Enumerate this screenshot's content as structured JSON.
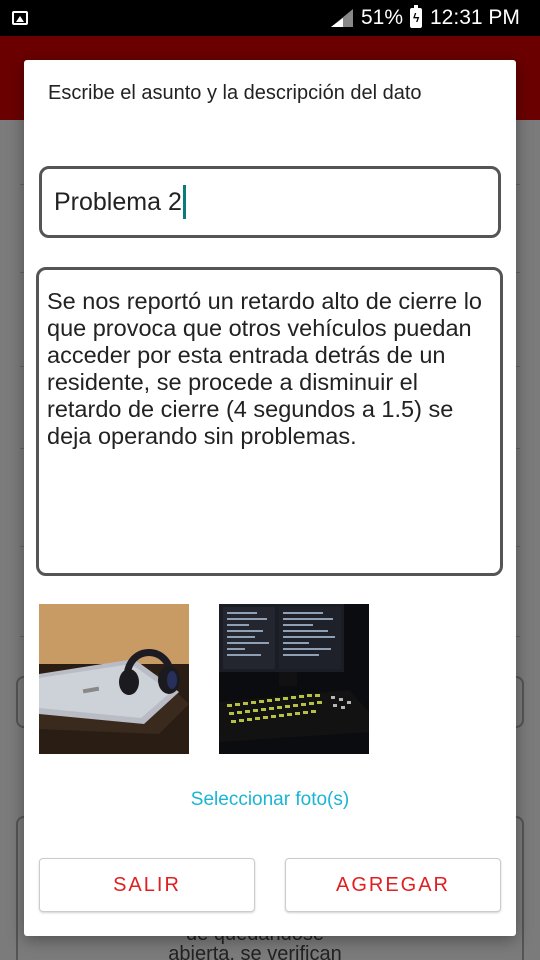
{
  "status_bar": {
    "battery_percent": "51%",
    "time": "12:31 PM",
    "icons": [
      "image-notification-icon",
      "signal-icon",
      "battery-charging-icon"
    ]
  },
  "background": {
    "partial_text": "de quedándose\nabierta, se verifican"
  },
  "dialog": {
    "title": "Escribe el asunto y la descripción del dato",
    "subject_value": "Problema 2",
    "description_value": "Se nos reportó un retardo alto de cierre lo que provoca que otros vehículos puedan acceder por esta entrada detrás de un residente, se procede a disminuir el retardo de cierre (4 segundos a 1.5) se deja operando sin problemas.",
    "photos": [
      "laptop-headphones-photo",
      "monitor-keyboard-photo"
    ],
    "select_photos_label": "Seleccionar foto(s)",
    "exit_label": "SALIR",
    "add_label": "AGREGAR"
  },
  "colors": {
    "accent_link": "#1bb5d4",
    "button_text": "#e02020",
    "header_brand": "#6b0000",
    "cursor": "#0a7a7a"
  }
}
